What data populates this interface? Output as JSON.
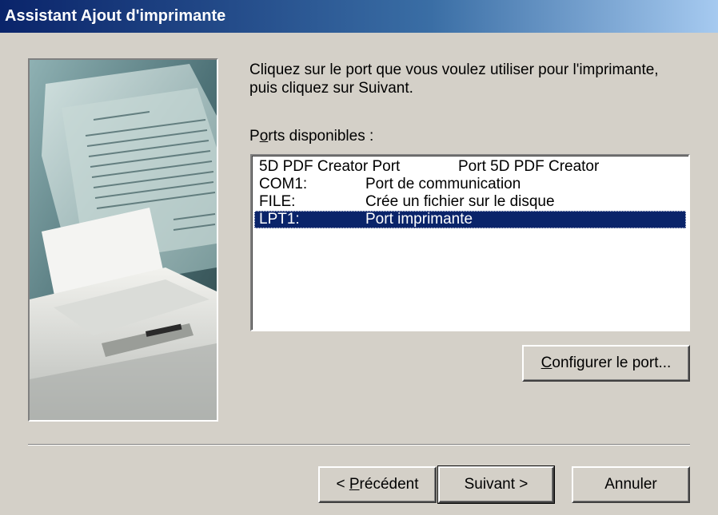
{
  "window": {
    "title": "Assistant Ajout d'imprimante"
  },
  "instruction": "Cliquez sur le port que vous voulez utiliser pour l'imprimante, puis cliquez sur Suivant.",
  "ports": {
    "label_prefix": "P",
    "label_mnemonic": "o",
    "label_rest": "rts disponibles :",
    "items": [
      {
        "port": "5D PDF Creator Port",
        "description": "Port 5D PDF Creator",
        "selected": false
      },
      {
        "port": "COM1:",
        "description": "Port de communication",
        "selected": false
      },
      {
        "port": "FILE:",
        "description": "Crée un fichier sur le disque",
        "selected": false
      },
      {
        "port": "LPT1:",
        "description": "Port imprimante",
        "selected": true
      }
    ]
  },
  "buttons": {
    "configure": {
      "mnemonic": "C",
      "rest": "onfigurer le port..."
    },
    "back": {
      "prefix": "< ",
      "mnemonic": "P",
      "rest": "récédent"
    },
    "next": "Suivant >",
    "cancel": "Annuler"
  },
  "colors": {
    "selection": "#0a246a",
    "titlebar_start": "#0a246a",
    "face": "#d4d0c8"
  },
  "illustration_icon": "printer-with-documents"
}
